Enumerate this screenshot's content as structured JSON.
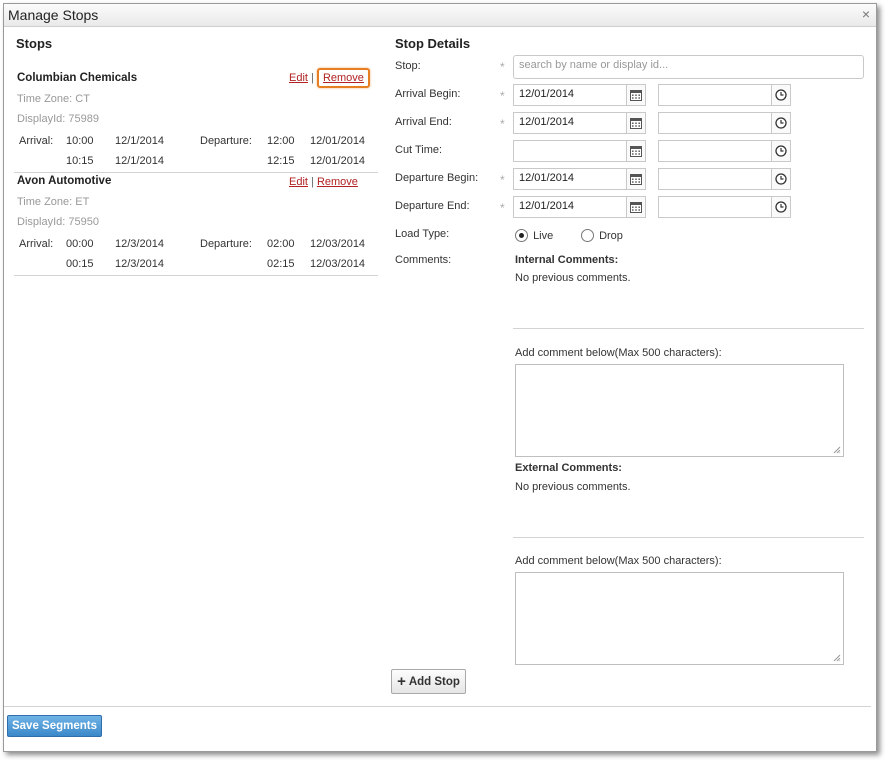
{
  "dialog": {
    "title": "Manage Stops",
    "close_glyph": "×"
  },
  "stops_panel": {
    "title": "Stops",
    "edit_label": "Edit",
    "separator": "|",
    "remove_label": "Remove",
    "arrival_label": "Arrival:",
    "departure_label": "Departure:",
    "stops": [
      {
        "name": "Columbian Chemicals",
        "time_zone": "Time Zone: CT",
        "display_id": "DisplayId: 75989",
        "arrival": [
          {
            "time": "10:00",
            "date": "12/1/2014"
          },
          {
            "time": "10:15",
            "date": "12/1/2014"
          }
        ],
        "departure": [
          {
            "time": "12:00",
            "date": "12/01/2014"
          },
          {
            "time": "12:15",
            "date": "12/01/2014"
          }
        ]
      },
      {
        "name": "Avon Automotive",
        "time_zone": "Time Zone: ET",
        "display_id": "DisplayId: 75950",
        "arrival": [
          {
            "time": "00:00",
            "date": "12/3/2014"
          },
          {
            "time": "00:15",
            "date": "12/3/2014"
          }
        ],
        "departure": [
          {
            "time": "02:00",
            "date": "12/03/2014"
          },
          {
            "time": "02:15",
            "date": "12/03/2014"
          }
        ]
      }
    ]
  },
  "details_panel": {
    "title": "Stop Details",
    "required_mark": "*",
    "stop_label": "Stop:",
    "stop_placeholder": "search by name or display id...",
    "rows": [
      {
        "label": "Arrival Begin:",
        "required": "*",
        "date": "12/01/2014",
        "time": ""
      },
      {
        "label": "Arrival End:",
        "required": "*",
        "date": "12/01/2014",
        "time": ""
      },
      {
        "label": "Cut Time:",
        "required": "",
        "date": "",
        "time": ""
      },
      {
        "label": "Departure Begin:",
        "required": "*",
        "date": "12/01/2014",
        "time": ""
      },
      {
        "label": "Departure End:",
        "required": "*",
        "date": "12/01/2014",
        "time": ""
      }
    ],
    "load_type_label": "Load Type:",
    "load_type_options": [
      "Live",
      "Drop"
    ],
    "load_type_selected": "Live",
    "comments_label": "Comments:",
    "internal_comments_title": "Internal Comments:",
    "internal_comments_text": "No previous comments.",
    "internal_add_label": "Add comment below(Max 500 characters):",
    "external_comments_title": "External Comments:",
    "external_comments_text": "No previous comments.",
    "external_add_label": "Add comment below(Max 500 characters):",
    "add_stop_label": "Add Stop",
    "add_stop_glyph": "+"
  },
  "footer": {
    "save_label": "Save Segments"
  },
  "icons": {
    "calendar": "calendar-icon",
    "clock": "clock-icon",
    "close": "close-icon",
    "plus": "plus-icon"
  },
  "colors": {
    "link": "#b22222",
    "highlight": "#e67e22",
    "save_button": "#3b88c9"
  }
}
